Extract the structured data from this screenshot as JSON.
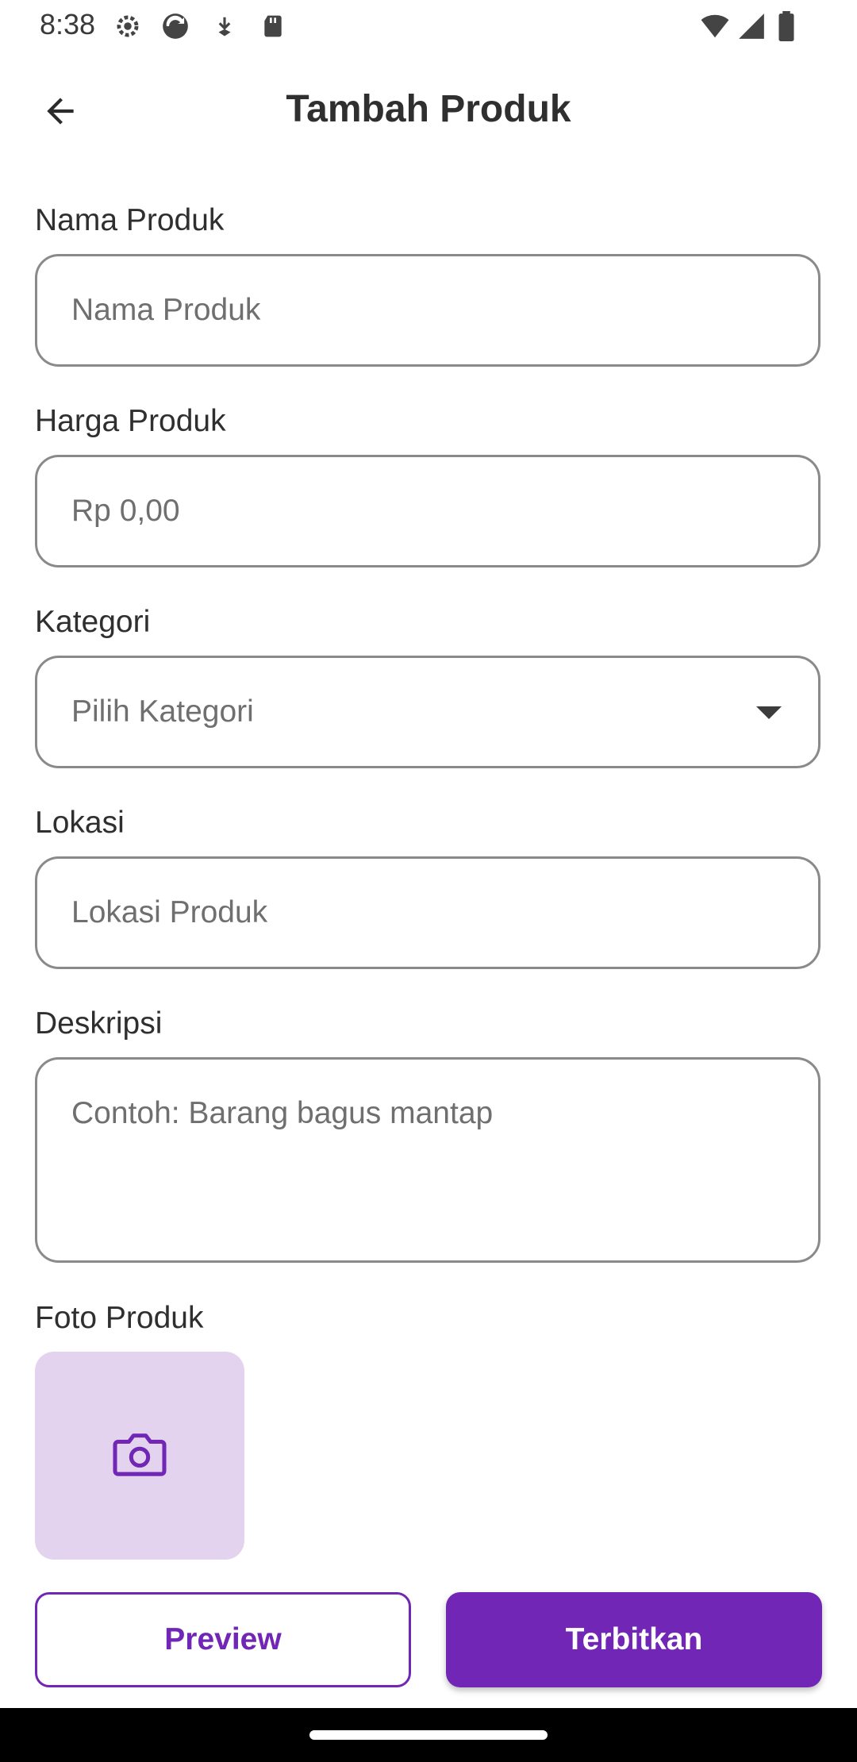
{
  "status_bar": {
    "time": "8:38",
    "icons": [
      "settings-gear-icon",
      "sync-icon",
      "download-icon",
      "sd-card-icon",
      "wifi-icon",
      "signal-icon",
      "battery-icon"
    ]
  },
  "app_bar": {
    "title": "Tambah Produk",
    "back_icon": "arrow-back-icon"
  },
  "form": {
    "name": {
      "label": "Nama Produk",
      "placeholder": "Nama Produk"
    },
    "price": {
      "label": "Harga Produk",
      "placeholder": "Rp 0,00"
    },
    "category": {
      "label": "Kategori",
      "placeholder": "Pilih Kategori",
      "arrow_icon": "dropdown-arrow-icon"
    },
    "location": {
      "label": "Lokasi",
      "placeholder": "Lokasi Produk"
    },
    "description": {
      "label": "Deskripsi",
      "placeholder": "Contoh: Barang bagus mantap"
    },
    "photo": {
      "label": "Foto Produk",
      "icon": "camera-icon"
    }
  },
  "actions": {
    "preview_label": "Preview",
    "publish_label": "Terbitkan"
  },
  "colors": {
    "primary": "#7126b5",
    "photo_bg": "#e3d3ef",
    "field_border": "#8a8a8a"
  }
}
